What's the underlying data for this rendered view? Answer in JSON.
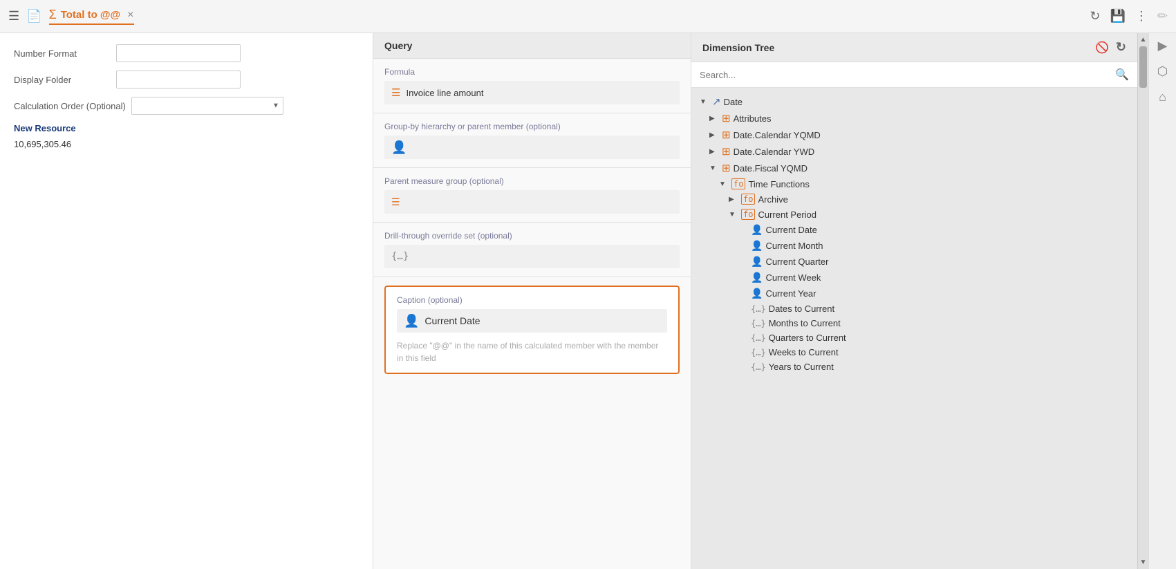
{
  "topbar": {
    "title": "Total to @@",
    "close_label": "×",
    "icons": {
      "refresh": "↻",
      "save": "💾",
      "more": "⋮",
      "pencil": "✏"
    }
  },
  "left_panel": {
    "number_format_label": "Number Format",
    "display_folder_label": "Display Folder",
    "calc_order_label": "Calculation Order (Optional)",
    "new_resource_label": "New Resource",
    "preview_value": "10,695,305.46"
  },
  "query_panel": {
    "header": "Query",
    "formula_label": "Formula",
    "formula_value": "Invoice line amount",
    "group_label": "Group-by hierarchy or parent member (optional)",
    "parent_label": "Parent measure group (optional)",
    "drill_label": "Drill-through override set (optional)",
    "caption_label": "Caption (optional)",
    "caption_value": "Current Date",
    "caption_hint": "Replace \"@@\" in the name of this calculated member with the member in this field"
  },
  "dimension_tree": {
    "header": "Dimension Tree",
    "search_placeholder": "Search...",
    "items": [
      {
        "level": 0,
        "arrow": "▼",
        "icon": "chart",
        "label": "Date",
        "icon_type": "date"
      },
      {
        "level": 1,
        "arrow": "▶",
        "icon": "hier",
        "label": "Attributes",
        "icon_type": "hier"
      },
      {
        "level": 1,
        "arrow": "▶",
        "icon": "hier",
        "label": "Date.Calendar YQMD",
        "icon_type": "hier"
      },
      {
        "level": 1,
        "arrow": "▶",
        "icon": "hier",
        "label": "Date.Calendar YWD",
        "icon_type": "hier"
      },
      {
        "level": 1,
        "arrow": "▼",
        "icon": "hier",
        "label": "Date.Fiscal YQMD",
        "icon_type": "hier"
      },
      {
        "level": 2,
        "arrow": "▼",
        "icon": "func",
        "label": "Time Functions",
        "icon_type": "func"
      },
      {
        "level": 3,
        "arrow": "▶",
        "icon": "func",
        "label": "Archive",
        "icon_type": "func"
      },
      {
        "level": 3,
        "arrow": "▼",
        "icon": "func",
        "label": "Current Period",
        "icon_type": "func"
      },
      {
        "level": 4,
        "arrow": "",
        "icon": "member",
        "label": "Current Date",
        "icon_type": "member"
      },
      {
        "level": 4,
        "arrow": "",
        "icon": "member",
        "label": "Current Month",
        "icon_type": "member"
      },
      {
        "level": 4,
        "arrow": "",
        "icon": "member",
        "label": "Current Quarter",
        "icon_type": "member"
      },
      {
        "level": 4,
        "arrow": "",
        "icon": "member",
        "label": "Current Week",
        "icon_type": "member"
      },
      {
        "level": 4,
        "arrow": "",
        "icon": "member",
        "label": "Current Year",
        "icon_type": "member"
      },
      {
        "level": 4,
        "arrow": "",
        "icon": "set",
        "label": "Dates to Current",
        "icon_type": "set"
      },
      {
        "level": 4,
        "arrow": "",
        "icon": "set",
        "label": "Months to Current",
        "icon_type": "set"
      },
      {
        "level": 4,
        "arrow": "",
        "icon": "set",
        "label": "Quarters to Current",
        "icon_type": "set"
      },
      {
        "level": 4,
        "arrow": "",
        "icon": "set",
        "label": "Weeks to Current",
        "icon_type": "set"
      },
      {
        "level": 4,
        "arrow": "",
        "icon": "set",
        "label": "Years to Current",
        "icon_type": "set"
      }
    ]
  }
}
